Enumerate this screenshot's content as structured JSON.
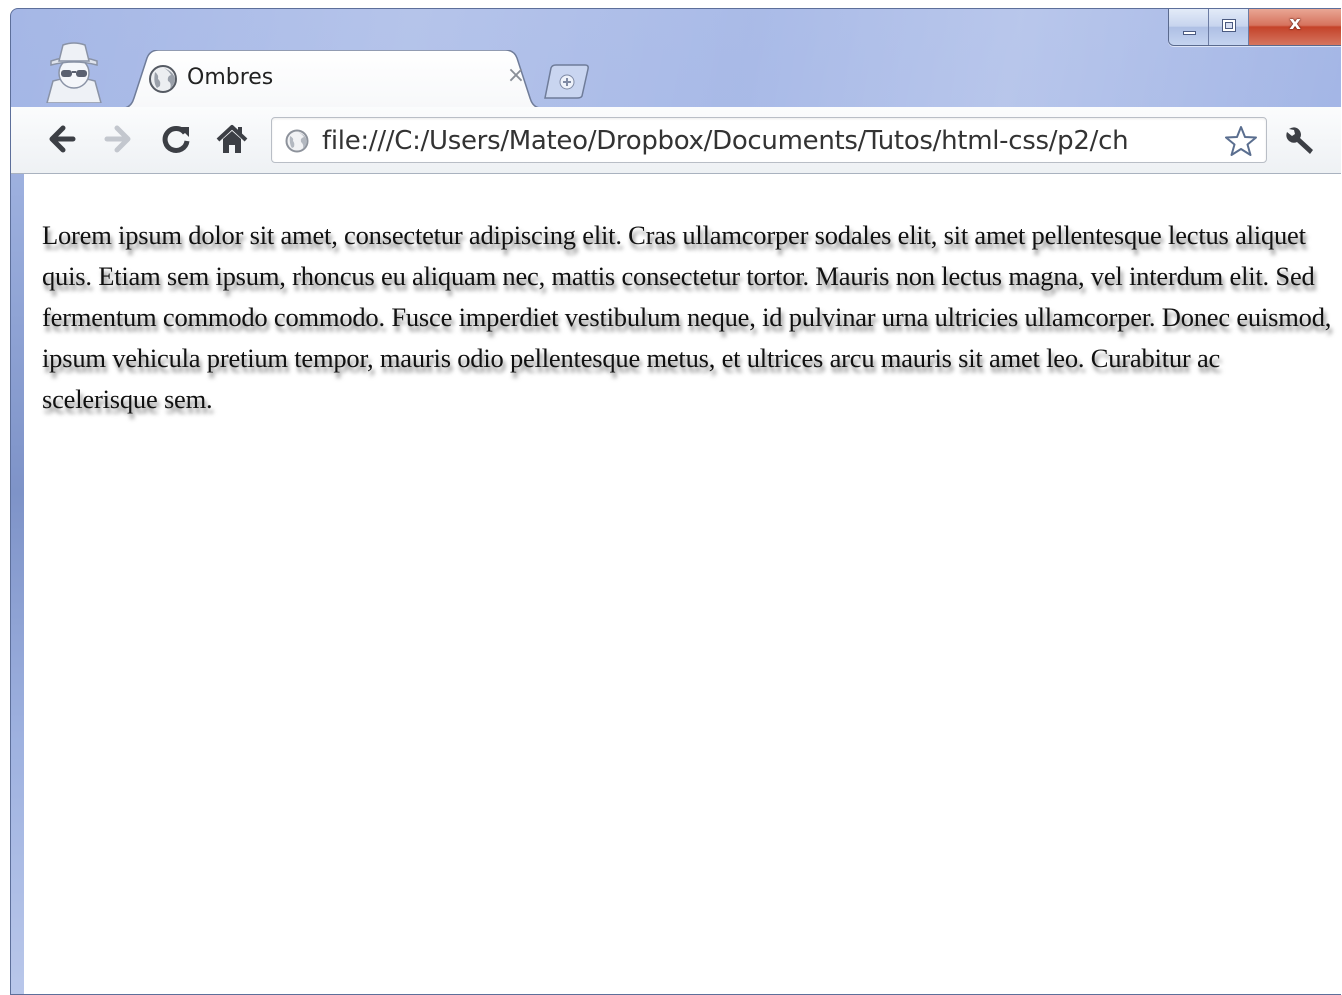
{
  "window": {
    "caption_buttons": {
      "minimize_icon": "minimize-icon",
      "maximize_icon": "maximize-icon",
      "close_symbol": "x"
    },
    "incognito_icon": "incognito-icon"
  },
  "tabs": [
    {
      "title": "Ombres",
      "favicon": "globe-icon",
      "close_symbol": "×",
      "active": true
    }
  ],
  "new_tab_icon": "plus-icon",
  "toolbar": {
    "back_icon": "back-arrow-icon",
    "forward_icon": "forward-arrow-icon",
    "reload_icon": "reload-icon",
    "home_icon": "home-icon",
    "address": {
      "icon": "page-globe-icon",
      "url": "file:///C:/Users/Mateo/Dropbox/Documents/Tutos/html-css/p2/ch",
      "star_icon": "bookmark-star-icon"
    },
    "wrench_icon": "wrench-icon"
  },
  "page": {
    "paragraph": "Lorem ipsum dolor sit amet, consectetur adipiscing elit. Cras ullamcorper sodales elit, sit amet pellentesque lectus aliquet quis. Etiam sem ipsum, rhoncus eu aliquam nec, mattis consectetur tortor. Mauris non lectus magna, vel interdum elit. Sed fermentum commodo commodo. Fusce imperdiet vestibulum neque, id pulvinar urna ultricies ullamcorper. Donec euismod, ipsum vehicula pretium tempor, mauris odio pellentesque metus, et ultrices arcu mauris sit amet leo. Curabitur ac scelerisque sem."
  },
  "colors": {
    "frame": "#9eb2e4",
    "close_button": "#c4432a",
    "text_shadow": "rgba(0,0,0,0.55)"
  }
}
